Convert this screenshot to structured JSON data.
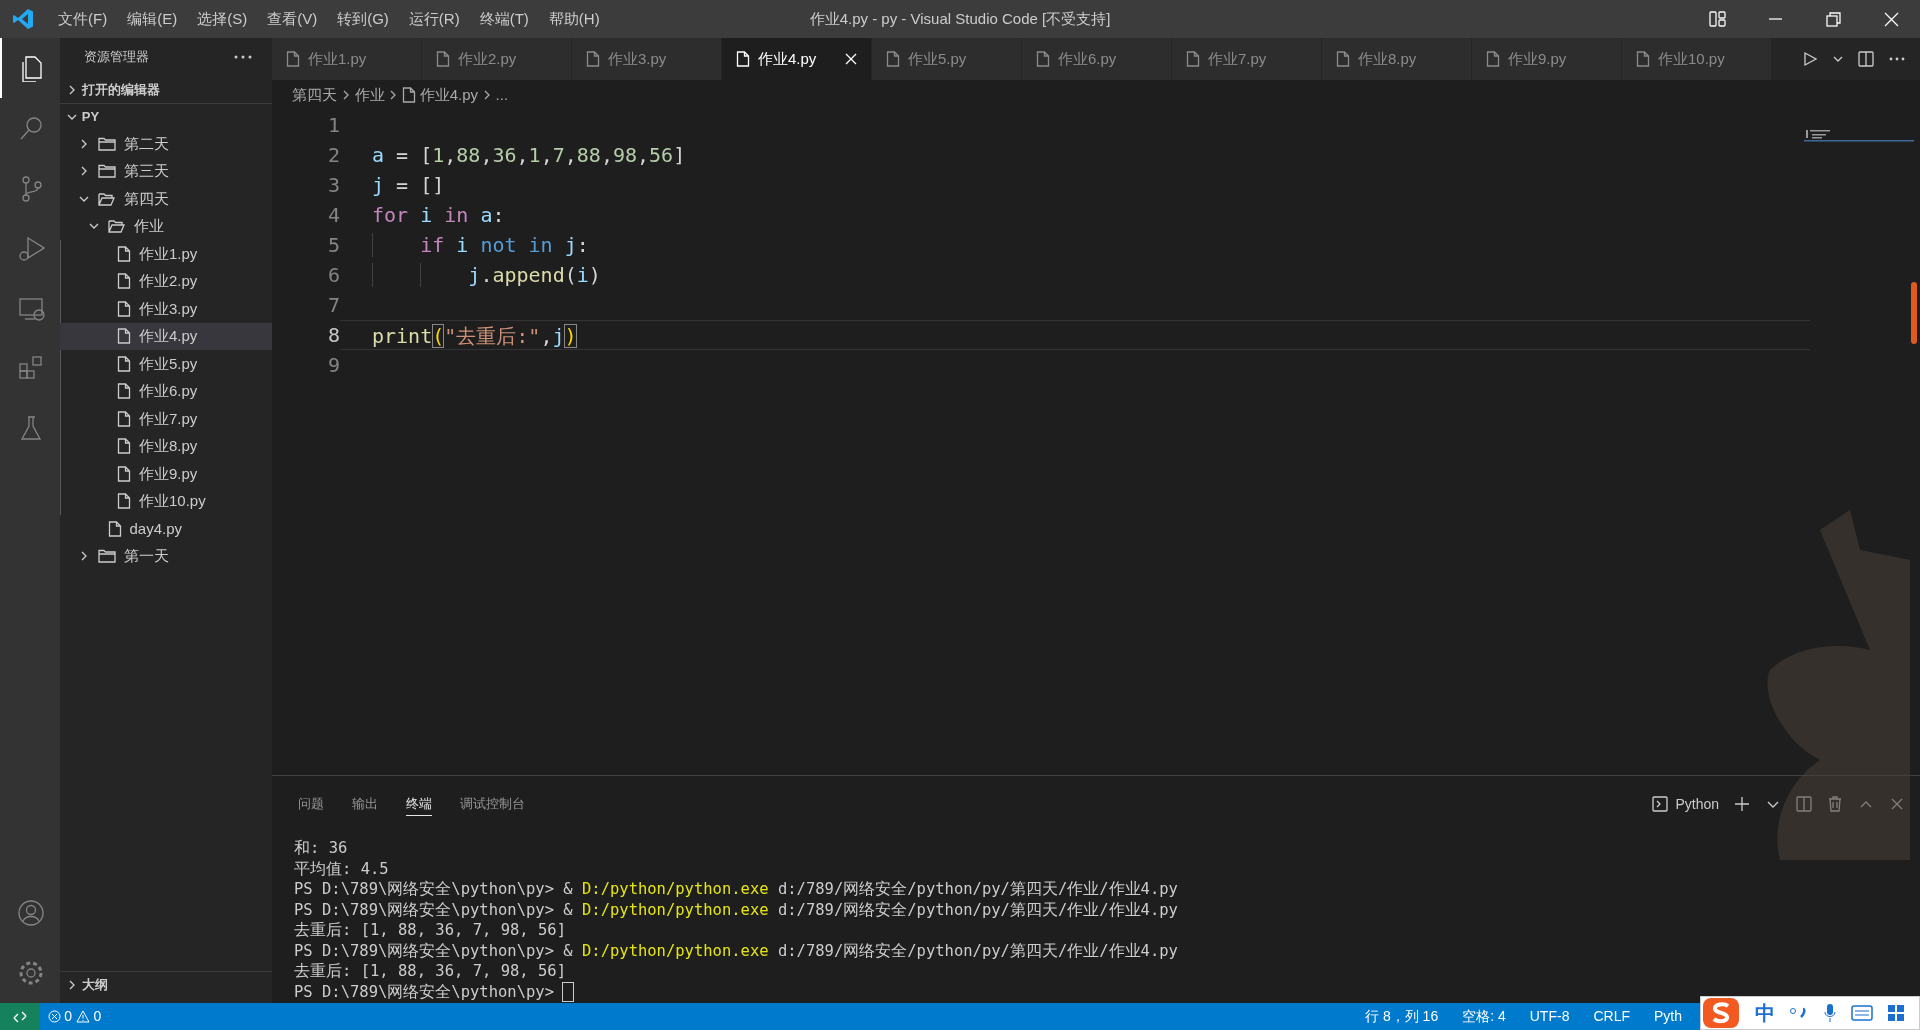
{
  "window": {
    "title": "作业4.py - py - Visual Studio Code [不受支持]"
  },
  "menu": [
    "文件(F)",
    "编辑(E)",
    "选择(S)",
    "查看(V)",
    "转到(G)",
    "运行(R)",
    "终端(T)",
    "帮助(H)"
  ],
  "activity_bar": {
    "top": [
      {
        "kind": "explorer",
        "selected": true
      },
      {
        "kind": "search",
        "selected": false
      },
      {
        "kind": "source-control",
        "selected": false
      },
      {
        "kind": "run-debug",
        "selected": false
      },
      {
        "kind": "remote",
        "selected": false
      },
      {
        "kind": "extensions",
        "selected": false
      },
      {
        "kind": "testing",
        "selected": false
      }
    ],
    "bottom": [
      {
        "kind": "account",
        "selected": false
      },
      {
        "kind": "settings",
        "selected": false
      }
    ]
  },
  "sidebar": {
    "title": "资源管理器",
    "open_editors": {
      "label": "打开的编辑器",
      "expanded": false
    },
    "tree": {
      "label": "PY",
      "expanded": true,
      "children": [
        {
          "label": "第二天",
          "kind": "folder",
          "expanded": false,
          "selected": false
        },
        {
          "label": "第三天",
          "kind": "folder",
          "expanded": false,
          "selected": false
        },
        {
          "label": "第四天",
          "kind": "folder",
          "expanded": true,
          "selected": false,
          "children": [
            {
              "label": "作业",
              "kind": "folder",
              "expanded": true,
              "selected": false,
              "children": [
                {
                  "label": "作业1.py",
                  "kind": "file",
                  "selected": false
                },
                {
                  "label": "作业2.py",
                  "kind": "file",
                  "selected": false
                },
                {
                  "label": "作业3.py",
                  "kind": "file",
                  "selected": false
                },
                {
                  "label": "作业4.py",
                  "kind": "file",
                  "selected": true
                },
                {
                  "label": "作业5.py",
                  "kind": "file",
                  "selected": false
                },
                {
                  "label": "作业6.py",
                  "kind": "file",
                  "selected": false
                },
                {
                  "label": "作业7.py",
                  "kind": "file",
                  "selected": false
                },
                {
                  "label": "作业8.py",
                  "kind": "file",
                  "selected": false
                },
                {
                  "label": "作业9.py",
                  "kind": "file",
                  "selected": false
                },
                {
                  "label": "作业10.py",
                  "kind": "file",
                  "selected": false
                }
              ]
            },
            {
              "label": "day4.py",
              "kind": "file",
              "selected": false
            }
          ]
        },
        {
          "label": "第一天",
          "kind": "folder",
          "expanded": false,
          "selected": false
        }
      ]
    },
    "outline": {
      "label": "大纲",
      "expanded": false
    }
  },
  "tabs": [
    {
      "label": "作业1.py",
      "selected": false
    },
    {
      "label": "作业2.py",
      "selected": false
    },
    {
      "label": "作业3.py",
      "selected": false
    },
    {
      "label": "作业4.py",
      "selected": true
    },
    {
      "label": "作业5.py",
      "selected": false
    },
    {
      "label": "作业6.py",
      "selected": false
    },
    {
      "label": "作业7.py",
      "selected": false
    },
    {
      "label": "作业8.py",
      "selected": false
    },
    {
      "label": "作业9.py",
      "selected": false
    },
    {
      "label": "作业10.py",
      "selected": false
    }
  ],
  "breadcrumb": [
    {
      "kind": "folder",
      "text": "第四天"
    },
    {
      "kind": "folder",
      "text": "作业"
    },
    {
      "kind": "file",
      "text": "作业4.py"
    },
    {
      "kind": "more",
      "text": "..."
    }
  ],
  "editor": {
    "lines": [
      {
        "number": "1",
        "current": false
      },
      {
        "number": "2",
        "current": false,
        "tokens": [
          {
            "kind": "var",
            "text": "a"
          },
          {
            "kind": "op",
            "text": " = "
          },
          {
            "kind": "punc",
            "text": "["
          },
          {
            "kind": "num",
            "text": "1"
          },
          {
            "kind": "punc",
            "text": ","
          },
          {
            "kind": "num",
            "text": "88"
          },
          {
            "kind": "punc",
            "text": ","
          },
          {
            "kind": "num",
            "text": "36"
          },
          {
            "kind": "punc",
            "text": ","
          },
          {
            "kind": "num",
            "text": "1"
          },
          {
            "kind": "punc",
            "text": ","
          },
          {
            "kind": "num",
            "text": "7"
          },
          {
            "kind": "punc",
            "text": ","
          },
          {
            "kind": "num",
            "text": "88"
          },
          {
            "kind": "punc",
            "text": ","
          },
          {
            "kind": "num",
            "text": "98"
          },
          {
            "kind": "punc",
            "text": ","
          },
          {
            "kind": "num",
            "text": "56"
          },
          {
            "kind": "punc",
            "text": "]"
          }
        ]
      },
      {
        "number": "3",
        "current": false,
        "tokens": [
          {
            "kind": "var",
            "text": "j"
          },
          {
            "kind": "op",
            "text": " = "
          },
          {
            "kind": "punc",
            "text": "[]"
          }
        ]
      },
      {
        "number": "4",
        "current": false,
        "tokens": [
          {
            "kind": "control",
            "text": "for"
          },
          {
            "kind": "var",
            "text": " i"
          },
          {
            "kind": "control",
            "text": " in"
          },
          {
            "kind": "var",
            "text": " a"
          },
          {
            "kind": "op",
            "text": ":"
          }
        ]
      },
      {
        "number": "5",
        "current": false,
        "tokens": [
          {
            "kind": "control",
            "text": "    if"
          },
          {
            "kind": "var",
            "text": " i"
          },
          {
            "kind": "keyword",
            "text": " not"
          },
          {
            "kind": "keyword",
            "text": " in"
          },
          {
            "kind": "var",
            "text": " j"
          },
          {
            "kind": "op",
            "text": ":"
          }
        ]
      },
      {
        "number": "6",
        "current": false,
        "tokens": [
          {
            "kind": "var",
            "text": "        j"
          },
          {
            "kind": "op",
            "text": "."
          },
          {
            "kind": "func",
            "text": "append"
          },
          {
            "kind": "punc",
            "text": "("
          },
          {
            "kind": "var",
            "text": "i"
          },
          {
            "kind": "punc",
            "text": ")"
          }
        ]
      },
      {
        "number": "7",
        "current": false
      },
      {
        "number": "8",
        "current": true,
        "tokens": [
          {
            "kind": "func",
            "text": "print"
          },
          {
            "kind": "bracket-match",
            "text": "("
          },
          {
            "kind": "str",
            "text": "\"去重后:\""
          },
          {
            "kind": "op",
            "text": ","
          },
          {
            "kind": "var",
            "text": "j"
          },
          {
            "kind": "bracket-match",
            "text": ")"
          }
        ]
      },
      {
        "number": "9",
        "current": false
      }
    ]
  },
  "panel": {
    "tabs": [
      {
        "label": "问题",
        "selected": false
      },
      {
        "label": "输出",
        "selected": false
      },
      {
        "label": "终端",
        "selected": true
      },
      {
        "label": "调试控制台",
        "selected": false
      }
    ],
    "terminal_name": "Python",
    "lines": [
      [
        {
          "kind": "plain",
          "text": "和: 36"
        }
      ],
      [
        {
          "kind": "plain",
          "text": "平均值: 4.5"
        }
      ],
      [
        {
          "kind": "plain",
          "text": "PS D:\\789\\网络安全\\python\\py> & "
        },
        {
          "kind": "exe",
          "text": "D:/python/python.exe"
        },
        {
          "kind": "plain",
          "text": " d:/789/网络安全/python/py/第四天/作业/作业4.py"
        }
      ],
      [
        {
          "kind": "plain",
          "text": "PS D:\\789\\网络安全\\python\\py> & "
        },
        {
          "kind": "exe",
          "text": "D:/python/python.exe"
        },
        {
          "kind": "plain",
          "text": " d:/789/网络安全/python/py/第四天/作业/作业4.py"
        }
      ],
      [
        {
          "kind": "plain",
          "text": "去重后: [1, 88, 36, 7, 98, 56]"
        }
      ],
      [
        {
          "kind": "plain",
          "text": "PS D:\\789\\网络安全\\python\\py> & "
        },
        {
          "kind": "exe",
          "text": "D:/python/python.exe"
        },
        {
          "kind": "plain",
          "text": " d:/789/网络安全/python/py/第四天/作业/作业4.py"
        }
      ],
      [
        {
          "kind": "plain",
          "text": "去重后: [1, 88, 36, 7, 98, 56]"
        }
      ],
      [
        {
          "kind": "plain",
          "text": "PS D:\\789\\网络安全\\python\\py> "
        },
        {
          "kind": "cursor"
        }
      ]
    ]
  },
  "status_bar": {
    "errors": "0",
    "warnings": "0",
    "items": [
      "行 8，列 16",
      "空格: 4",
      "UTF-8",
      "CRLF",
      "Pyth"
    ]
  },
  "ime_toolbar": {
    "mode": "中"
  }
}
